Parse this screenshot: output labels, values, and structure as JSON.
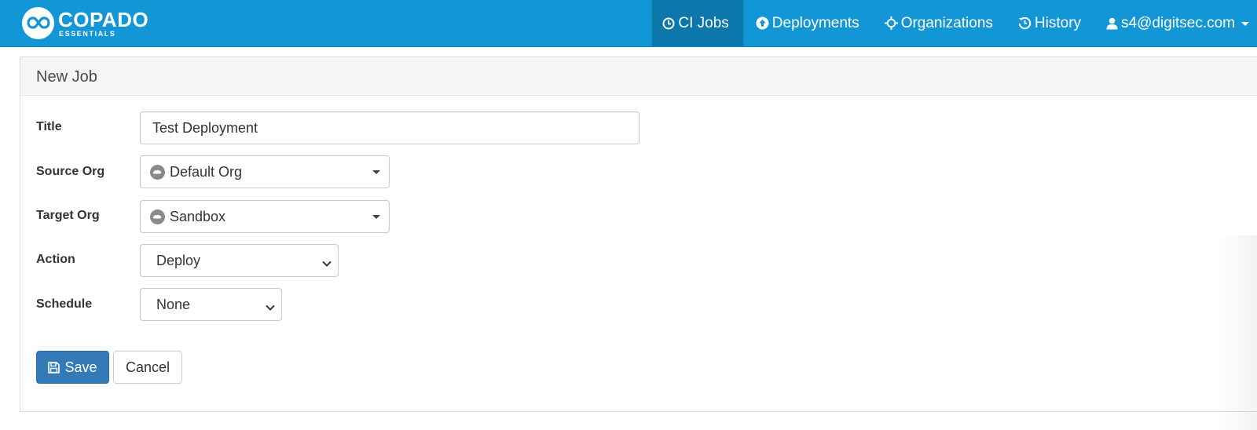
{
  "brand": {
    "name": "COPADO",
    "sub": "ESSENTIALS",
    "logo_icon": "infinity-icon"
  },
  "nav": {
    "items": [
      {
        "label": "CI Jobs",
        "icon": "clock-icon",
        "active": true
      },
      {
        "label": "Deployments",
        "icon": "upload-circle-icon"
      },
      {
        "label": "Organizations",
        "icon": "crosshair-icon"
      },
      {
        "label": "History",
        "icon": "history-icon"
      }
    ],
    "user": {
      "label": "s4@digitsec.com",
      "icon": "user-icon"
    }
  },
  "panel": {
    "heading": "New Job"
  },
  "form": {
    "title_label": "Title",
    "title_value": "Test Deployment",
    "source_label": "Source Org",
    "source_value": "Default Org",
    "target_label": "Target Org",
    "target_value": "Sandbox",
    "action_label": "Action",
    "action_value": "Deploy",
    "schedule_label": "Schedule",
    "schedule_value": "None"
  },
  "buttons": {
    "save": "Save",
    "cancel": "Cancel"
  },
  "colors": {
    "navbar": "#1296d6",
    "nav_active": "#0c77aa",
    "primary_button": "#337ab7"
  }
}
